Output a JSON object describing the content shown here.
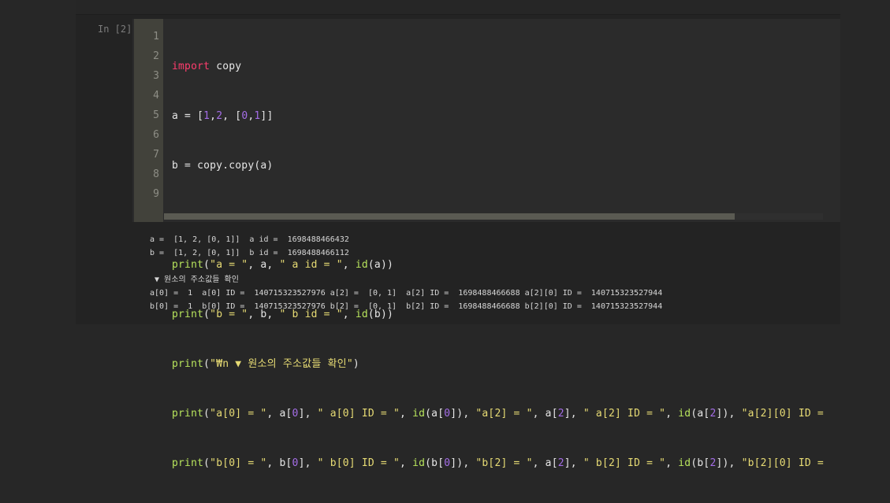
{
  "cell": {
    "prompt": "In [2]:",
    "line_numbers": [
      "1",
      "2",
      "3",
      "4",
      "5",
      "6",
      "7",
      "8",
      "9"
    ],
    "code_lines": [
      "import copy",
      "a = [1,2, [0,1]]",
      "b = copy.copy(a)",
      "",
      "print(\"a = \", a, \" a id = \", id(a))",
      "print(\"b = \", b, \" b id = \", id(b))",
      "print(\"₩n ▼ 원소의 주소값들 확인\")",
      "print(\"a[0] = \", a[0], \" a[0] ID = \", id(a[0]), \"a[2] = \", a[2], \" a[2] ID = \", id(a[2]), \"a[2][0] ID = ",
      "print(\"b[0] = \", b[0], \" b[0] ID = \", id(b[0]), \"b[2] = \", a[2], \" b[2] ID = \", id(b[2]), \"b[2][0] ID = "
    ]
  },
  "output": {
    "lines": [
      "a =  [1, 2, [0, 1]]  a id =  1698488466432",
      "b =  [1, 2, [0, 1]]  b id =  1698488466112",
      "",
      " ▼ 원소의 주소값들 확인",
      "a[0] =  1  a[0] ID =  140715323527976 a[2] =  [0, 1]  a[2] ID =  1698488466688 a[2][0] ID =  140715323527944",
      "b[0] =  1  b[0] ID =  140715323527976 b[2] =  [0, 1]  b[2] ID =  1698488466688 b[2][0] ID =  140715323527944"
    ]
  },
  "colors": {
    "keyword": "#ff3d6e",
    "function": "#b7e35c",
    "string": "#e7db74",
    "number": "#a56ee8"
  }
}
